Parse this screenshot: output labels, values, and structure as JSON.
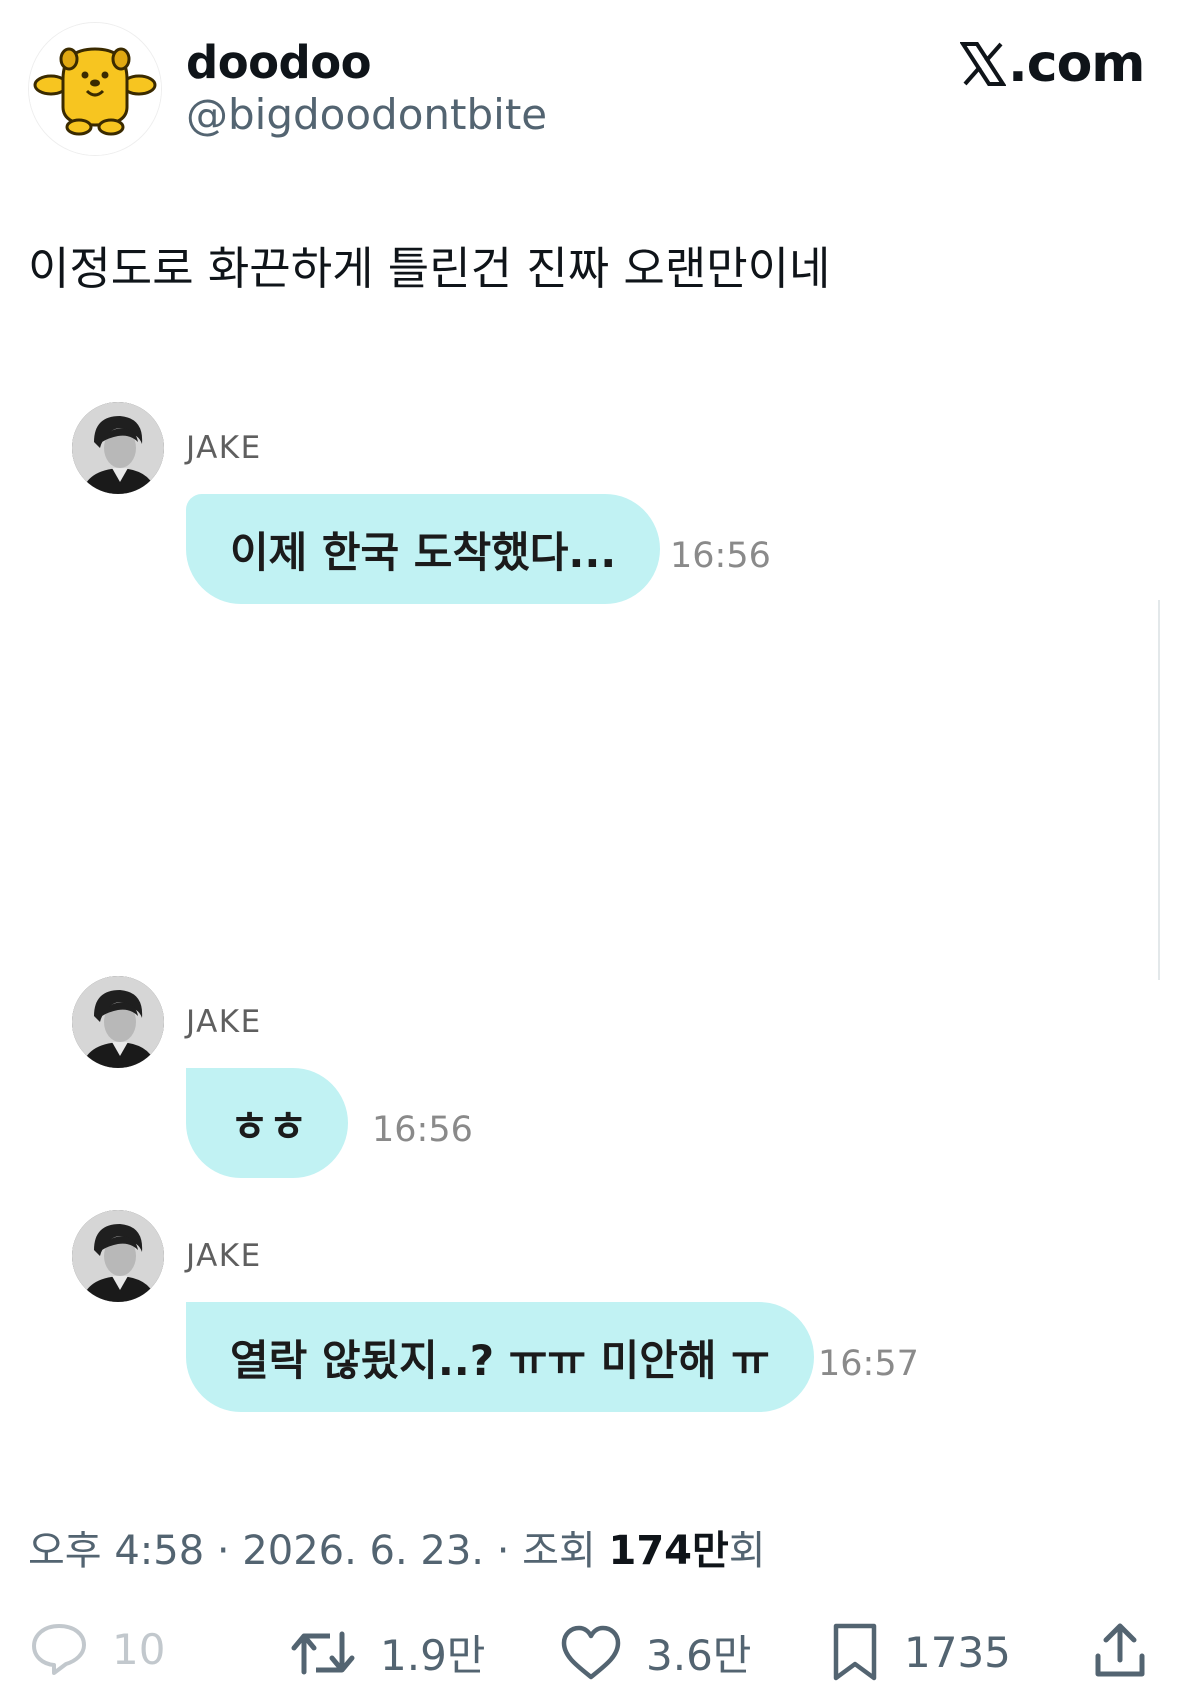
{
  "header": {
    "display_name": "doodoo",
    "handle": "@bigdoodontbite",
    "brand": ".com",
    "brand_icon": "x-logo-icon"
  },
  "tweet": {
    "text": "이정도로 화끈하게 틀린건 진짜 오랜만이네"
  },
  "chat": {
    "accent": "#c1f2f3",
    "messages": [
      {
        "sender": "JAKE",
        "text": "이제 한국 도착했다...",
        "time": "16:56"
      },
      {
        "sender": "JAKE",
        "text": "ㅎㅎ",
        "time": "16:56"
      },
      {
        "sender": "JAKE",
        "text": "열락 않됬지..? ㅠㅠ 미안해 ㅠ",
        "time": "16:57"
      }
    ]
  },
  "meta": {
    "time": "오후 4:58",
    "date": "2026. 6. 23.",
    "views_label": "조회",
    "views_number": "174만",
    "views_suffix": "회"
  },
  "actions": {
    "replies": "10",
    "retweets": "1.9만",
    "likes": "3.6만",
    "bookmarks": "1735"
  }
}
